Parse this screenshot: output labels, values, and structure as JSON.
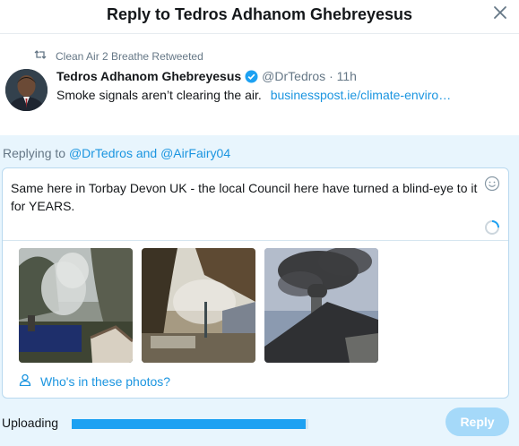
{
  "dialog": {
    "title": "Reply to Tedros Adhanom Ghebreyesus",
    "close_icon": "close-icon"
  },
  "tweet": {
    "retweet_text": "Clean Air 2 Breathe Retweeted",
    "author_name": "Tedros Adhanom Ghebreyesus",
    "author_handle": "@DrTedros",
    "time": "11h",
    "text": "Smoke signals aren’t clearing the air.",
    "link": "businesspost.ie/climate-enviro…"
  },
  "compose": {
    "replying_prefix": "Replying to",
    "mention_1": "@DrTedros",
    "and_word": "and",
    "mention_2": "@AirFairy04",
    "draft_text": "Same here in Torbay Devon UK - the local Council here have turned a blind-eye to it for YEARS.",
    "tag_photos_label": "Who's in these photos?",
    "photo_count": 3
  },
  "footer": {
    "uploading_label": "Uploading",
    "upload_progress": 0.99,
    "reply_label": "Reply"
  },
  "colors": {
    "accent": "#1da1f2",
    "link": "#1b95e0",
    "compose_bg": "#e8f5fd",
    "reply_disabled": "#a5d9f9"
  }
}
